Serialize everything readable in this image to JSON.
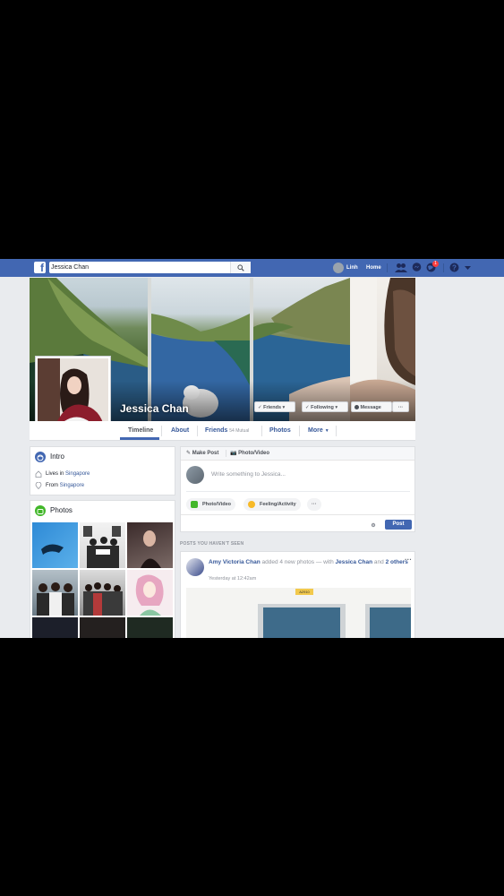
{
  "topbar": {
    "search_value": "Jessica Chan",
    "user_name": "Linh",
    "home_label": "Home",
    "notifications_count": "1",
    "brand_color": "#4267b2"
  },
  "profile": {
    "name": "Jessica Chan",
    "buttons": {
      "friends": "Friends",
      "following": "Following",
      "message": "Message",
      "more": "···"
    }
  },
  "nav": {
    "timeline": "Timeline",
    "about": "About",
    "friends": "Friends",
    "friends_mutual": "54 Mutual",
    "photos": "Photos",
    "more": "More"
  },
  "intro": {
    "title": "Intro",
    "lives_prefix": "Lives in ",
    "lives_place": "Singapore",
    "from_prefix": "From ",
    "from_place": "Singapore"
  },
  "photos": {
    "title": "Photos"
  },
  "composer": {
    "tab_make_post": "Make Post",
    "tab_photo_video": "Photo/Video",
    "placeholder": "Write something to Jessica...",
    "btn_photo_video": "Photo/Video",
    "btn_feeling": "Feeling/Activity",
    "btn_more": "···",
    "post_label": "Post"
  },
  "feed": {
    "section_label": "POSTS YOU HAVEN'T SEEN",
    "author": "Amy Victoria Chan",
    "action": " added 4 new photos — with ",
    "tagged": "Jessica Chan",
    "and": " and ",
    "others": "2 others",
    "time": "Yesterday at 12:42am",
    "sign_text": "A2910",
    "menu": "···"
  }
}
